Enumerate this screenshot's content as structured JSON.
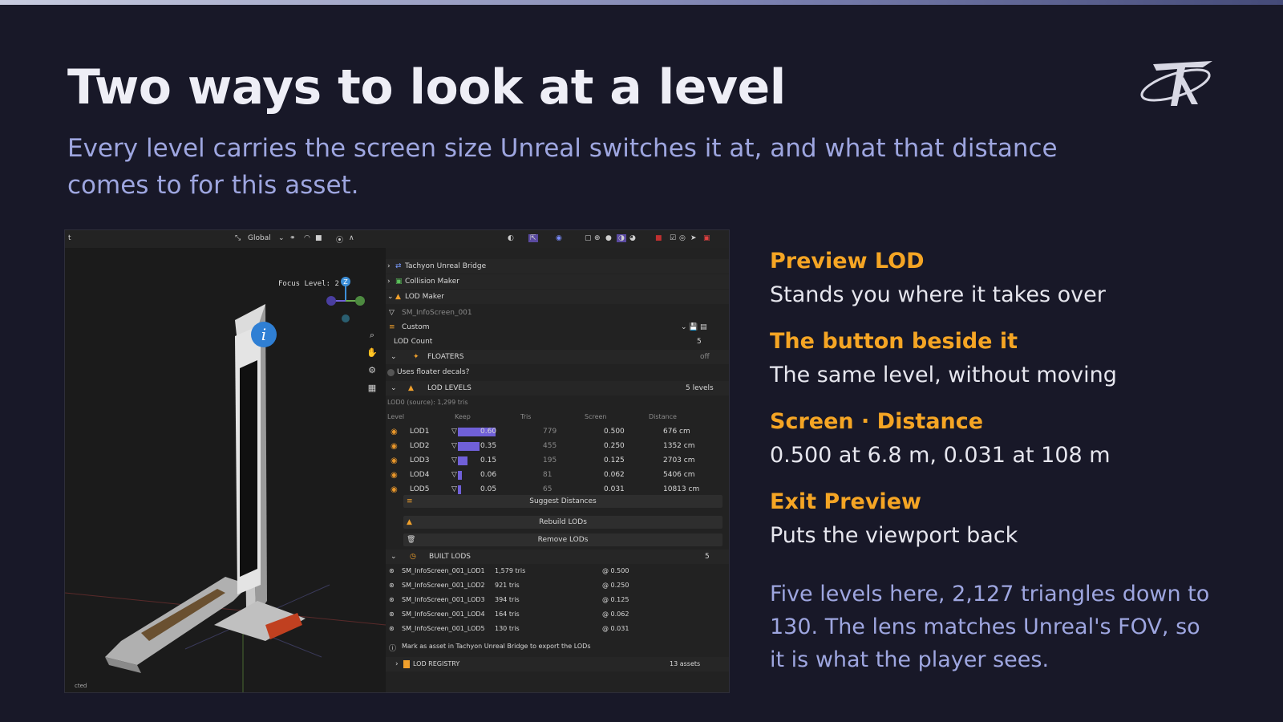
{
  "slide": {
    "title": "Two ways to look at a level",
    "subtitle": "Every level carries the screen size Unreal switches it at, and what that distance comes to for this asset."
  },
  "screenshot": {
    "header": {
      "left_label": "t",
      "orientation": "Global"
    },
    "viewport": {
      "focus_label": "Focus Level: 2",
      "gizmo_top": "Z",
      "footer": "cted"
    },
    "panels": {
      "bridge": "Tachyon Unreal Bridge",
      "collision": "Collision Maker",
      "lod_maker": "LOD Maker"
    },
    "lod_maker": {
      "mesh": "SM_InfoScreen_001",
      "preset": "Custom",
      "lod_count_label": "LOD Count",
      "lod_count": "5",
      "floaters_label": "FLOATERS",
      "floaters_state": "off",
      "floaters_checkbox": "Uses floater decals?",
      "levels_label": "LOD LEVELS",
      "levels_count": "5 levels",
      "source_line": "LOD0 (source): 1,299 tris",
      "columns": [
        "Level",
        "Keep",
        "Tris",
        "Screen",
        "Distance"
      ],
      "levels": [
        {
          "name": "LOD1",
          "keep": "0.60",
          "keep_value": 0.6,
          "tris": "779",
          "screen": "0.500",
          "distance": "676 cm"
        },
        {
          "name": "LOD2",
          "keep": "0.35",
          "keep_value": 0.35,
          "tris": "455",
          "screen": "0.250",
          "distance": "1352 cm"
        },
        {
          "name": "LOD3",
          "keep": "0.15",
          "keep_value": 0.15,
          "tris": "195",
          "screen": "0.125",
          "distance": "2703 cm"
        },
        {
          "name": "LOD4",
          "keep": "0.06",
          "keep_value": 0.06,
          "tris": "81",
          "screen": "0.062",
          "distance": "5406 cm"
        },
        {
          "name": "LOD5",
          "keep": "0.05",
          "keep_value": 0.05,
          "tris": "65",
          "screen": "0.031",
          "distance": "10813 cm"
        }
      ],
      "suggest_button": "Suggest Distances",
      "rebuild_button": "Rebuild LODs",
      "remove_button": "Remove LODs",
      "built_label": "BUILT LODS",
      "built_count": "5",
      "built": [
        {
          "name": "SM_InfoScreen_001_LOD1",
          "tris": "1,579 tris",
          "screen": "@ 0.500"
        },
        {
          "name": "SM_InfoScreen_001_LOD2",
          "tris": "921 tris",
          "screen": "@ 0.250"
        },
        {
          "name": "SM_InfoScreen_001_LOD3",
          "tris": "394 tris",
          "screen": "@ 0.125"
        },
        {
          "name": "SM_InfoScreen_001_LOD4",
          "tris": "164 tris",
          "screen": "@ 0.062"
        },
        {
          "name": "SM_InfoScreen_001_LOD5",
          "tris": "130 tris",
          "screen": "@ 0.031"
        }
      ],
      "asset_note": "Mark as asset in Tachyon Unreal Bridge to export the LODs",
      "registry_label": "LOD REGISTRY",
      "registry_count": "13 assets"
    }
  },
  "features": [
    {
      "heading": "Preview LOD",
      "text": "Stands you where it takes over"
    },
    {
      "heading": "The button beside it",
      "text": "The same level, without moving"
    },
    {
      "heading": "Screen · Distance",
      "text": "0.500 at 6.8 m, 0.031 at 108 m"
    },
    {
      "heading": "Exit Preview",
      "text": "Puts the viewport back"
    }
  ],
  "note": "Five levels here, 2,127 triangles down to 130. The lens matches Unreal's FOV, so it is what the player sees.",
  "colors": {
    "background": "#181828",
    "accent": "#f5a524",
    "subtitle": "#9ea6e0",
    "bar": "#7060d8"
  }
}
